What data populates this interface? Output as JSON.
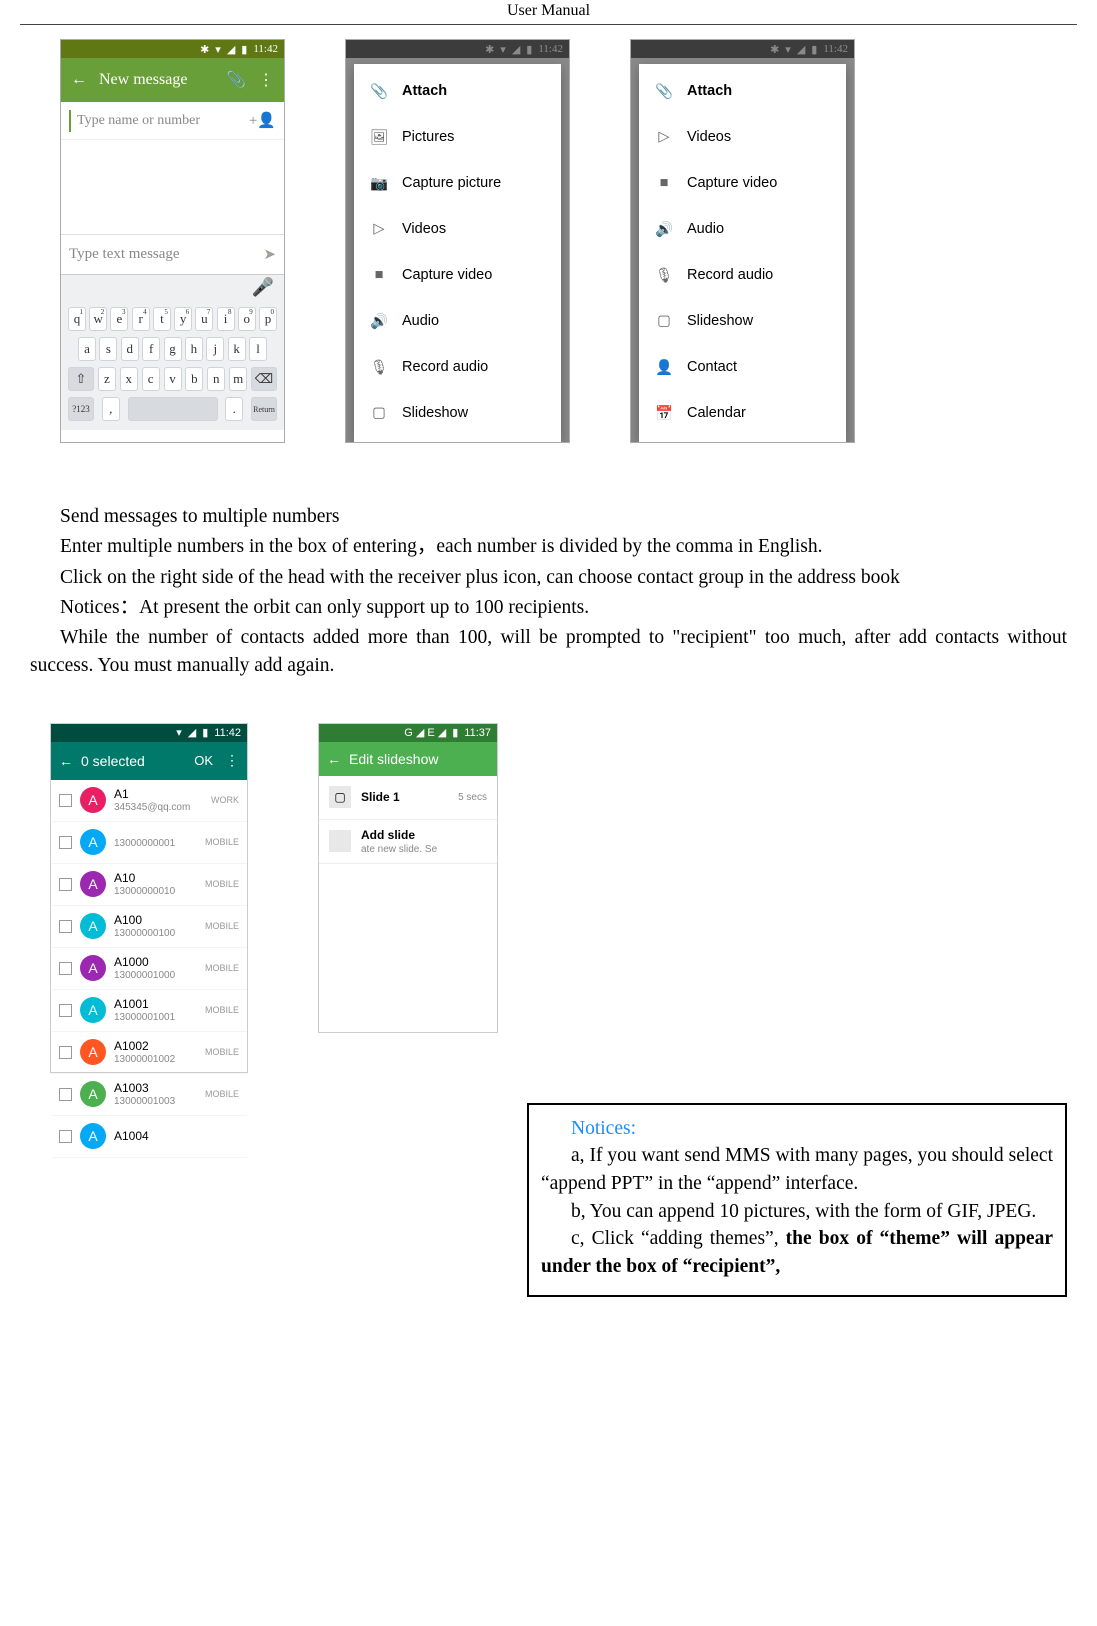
{
  "page_title": "User    Manual",
  "status_time": "11:42",
  "status_bt": "✱",
  "status_wifi": "▾",
  "status_sig": "◢",
  "status_bat": "▮",
  "phone1": {
    "app_title": "New message",
    "back": "←",
    "attach": "📎",
    "more": "⋮",
    "to_placeholder": "Type name or number",
    "add_contact": "+👤",
    "msg_placeholder": "Type text message",
    "send": "➤",
    "mic": "🎤",
    "kb_r1": [
      "q",
      "w",
      "e",
      "r",
      "t",
      "y",
      "u",
      "i",
      "o",
      "p"
    ],
    "kb_r1n": [
      "1",
      "2",
      "3",
      "4",
      "5",
      "6",
      "7",
      "8",
      "9",
      "0"
    ],
    "kb_r2": [
      "a",
      "s",
      "d",
      "f",
      "g",
      "h",
      "j",
      "k",
      "l"
    ],
    "kb_r3": [
      "z",
      "x",
      "c",
      "v",
      "b",
      "n",
      "m"
    ],
    "shift": "⇧",
    "back_key": "⌫",
    "num": "?123",
    "comma": ",",
    "dot": ".",
    "return": "Return"
  },
  "attach_menu": {
    "header": "Attach",
    "items": [
      {
        "icon": "picture-icon",
        "label": "Pictures",
        "glyph": "🖼"
      },
      {
        "icon": "camera-icon",
        "label": "Capture picture",
        "glyph": "📷"
      },
      {
        "icon": "video-icon",
        "label": "Videos",
        "glyph": "▷"
      },
      {
        "icon": "camcorder-icon",
        "label": "Capture video",
        "glyph": "■"
      },
      {
        "icon": "audio-icon",
        "label": "Audio",
        "glyph": "🔊"
      },
      {
        "icon": "mic-icon",
        "label": "Record audio",
        "glyph": "🎙"
      },
      {
        "icon": "slideshow-icon",
        "label": "Slideshow",
        "glyph": "▢"
      }
    ]
  },
  "attach_menu2": {
    "header": "Attach",
    "items": [
      {
        "icon": "video-icon",
        "label": "Videos",
        "glyph": "▷"
      },
      {
        "icon": "camcorder-icon",
        "label": "Capture video",
        "glyph": "■"
      },
      {
        "icon": "audio-icon",
        "label": "Audio",
        "glyph": "🔊"
      },
      {
        "icon": "mic-icon",
        "label": "Record audio",
        "glyph": "🎙"
      },
      {
        "icon": "slideshow-icon",
        "label": "Slideshow",
        "glyph": "▢"
      },
      {
        "icon": "contact-icon",
        "label": "Contact",
        "glyph": "👤"
      },
      {
        "icon": "calendar-icon",
        "label": "Calendar",
        "glyph": "📅"
      }
    ]
  },
  "body": {
    "h": "Send messages to multiple numbers",
    "p1": "Enter multiple numbers in the box of entering，each number is divided by the comma in English.",
    "p2": "Click on the right side of the head with the receiver plus icon, can choose contact group in the address book",
    "p3": "Notices：At present the orbit can only support up to 100 recipients.",
    "p4": "While the number of contacts added more than 100, will be prompted to \"recipient\" too much, after add contacts without success. You must manually add again."
  },
  "contacts_screen": {
    "title": "0 selected",
    "ok": "OK",
    "back": "←",
    "more": "⋮",
    "time": "11:42",
    "list": [
      {
        "c": "c0",
        "nm": "A1",
        "sub": "345345@qq.com",
        "type": "WORK"
      },
      {
        "c": "c1",
        "nm": "",
        "sub": "13000000001",
        "type": "MOBILE"
      },
      {
        "c": "c2",
        "nm": "A10",
        "sub": "13000000010",
        "type": "MOBILE"
      },
      {
        "c": "c3",
        "nm": "A100",
        "sub": "13000000100",
        "type": "MOBILE"
      },
      {
        "c": "c2",
        "nm": "A1000",
        "sub": "13000001000",
        "type": "MOBILE"
      },
      {
        "c": "c3",
        "nm": "A1001",
        "sub": "13000001001",
        "type": "MOBILE"
      },
      {
        "c": "c4",
        "nm": "A1002",
        "sub": "13000001002",
        "type": "MOBILE"
      },
      {
        "c": "c5",
        "nm": "A1003",
        "sub": "13000001003",
        "type": "MOBILE"
      },
      {
        "c": "c6",
        "nm": "A1004",
        "sub": "",
        "type": ""
      }
    ]
  },
  "slide_screen": {
    "title": "Edit slideshow",
    "back": "←",
    "time": "11:37",
    "net": "G ◢ E ◢",
    "rows": [
      {
        "glyph": "▢",
        "t": "Slide 1",
        "s": "",
        "time": "5 secs"
      },
      {
        "glyph": "",
        "t": "Add slide",
        "s": "ate new slide.             Se",
        "time": ""
      }
    ]
  },
  "notices": {
    "title": "Notices:",
    "a": "a, If you want send MMS with many pages, you should select “append PPT” in the “append” interface.",
    "b": "b, You can append 10 pictures, with the form of GIF, JPEG.",
    "c_1": "c, Click “adding themes”, ",
    "c_bold": "the box of “theme” will appear under the box of “recipient”,"
  }
}
